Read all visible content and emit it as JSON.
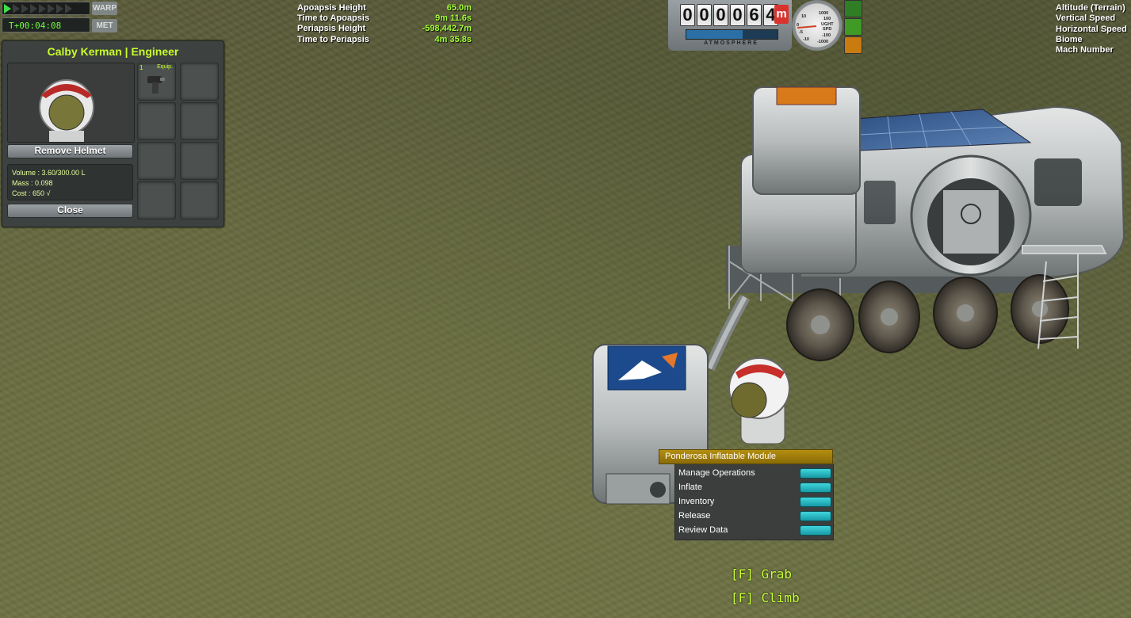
{
  "warp": {
    "label": "WARP",
    "met_label": "MET",
    "timer": "T+00:04:08",
    "arrows_active": 1,
    "arrows_total": 8
  },
  "kerbal_panel": {
    "title": "Calby Kerman | Engineer",
    "remove_helmet": "Remove Helmet",
    "volume": "Volume : 3.60/300.00 L",
    "mass": "Mass : 0.098",
    "cost": "Cost : 650 √",
    "close": "Close",
    "slot_item": {
      "count": "1",
      "label": "Equip."
    }
  },
  "orbit": {
    "rows": [
      {
        "label": "Apoapsis Height",
        "value": "65.0m"
      },
      {
        "label": "Time to Apoapsis",
        "value": "9m 11.6s"
      },
      {
        "label": "Periapsis Height",
        "value": "-598,442.7m"
      },
      {
        "label": "Time to Periapsis",
        "value": "4m 35.8s"
      }
    ]
  },
  "altimeter": {
    "digits": [
      "0",
      "0",
      "0",
      "0",
      "6",
      "4"
    ],
    "unit": "m",
    "atmosphere_label": "ATMOSPHERE",
    "atmosphere_level": 0.62,
    "dial_labels": [
      "1000",
      "100",
      "10",
      "UGHT",
      "SPD",
      "-100",
      "-1000",
      "0",
      "-5",
      "-10"
    ],
    "colors": {
      "unit": "#d8332f",
      "mode_top": "#2f7d24",
      "mode_mid": "#3f9a26",
      "mode_bot": "#c97b10"
    }
  },
  "flight_data": {
    "rows": [
      "Altitude (Terrain)",
      "Vertical Speed",
      "Horizontal Speed",
      "Biome",
      "Mach Number"
    ]
  },
  "paw": {
    "title": "Ponderosa Inflatable Module",
    "items": [
      "Manage Operations",
      "Inflate",
      "Inventory",
      "Release",
      "Review Data"
    ]
  },
  "hints": [
    "[F] Grab",
    "[F] Climb"
  ]
}
